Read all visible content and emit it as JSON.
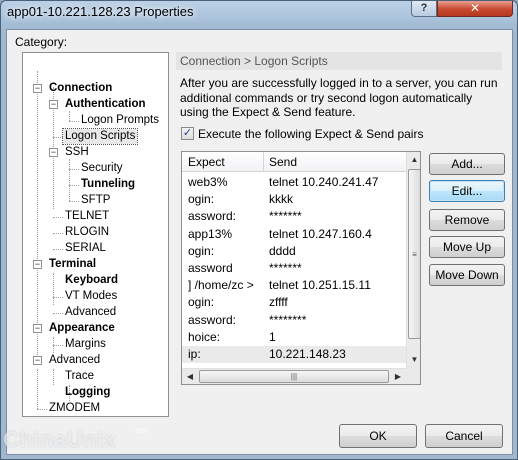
{
  "window": {
    "title": "app01-10.221.128.23 Properties",
    "help_label": "?",
    "close_label": "✕"
  },
  "category_label": "Category:",
  "tree": [
    {
      "label": "Connection",
      "bold": true,
      "selected": false
    },
    {
      "label": "Authentication",
      "bold": true,
      "selected": false
    },
    {
      "label": "Logon Prompts",
      "bold": false,
      "selected": false
    },
    {
      "label": "Logon Scripts",
      "bold": false,
      "selected": true
    },
    {
      "label": "SSH",
      "bold": false,
      "selected": false
    },
    {
      "label": "Security",
      "bold": false,
      "selected": false
    },
    {
      "label": "Tunneling",
      "bold": true,
      "selected": false
    },
    {
      "label": "SFTP",
      "bold": false,
      "selected": false
    },
    {
      "label": "TELNET",
      "bold": false,
      "selected": false
    },
    {
      "label": "RLOGIN",
      "bold": false,
      "selected": false
    },
    {
      "label": "SERIAL",
      "bold": false,
      "selected": false
    },
    {
      "label": "Terminal",
      "bold": true,
      "selected": false
    },
    {
      "label": "Keyboard",
      "bold": true,
      "selected": false
    },
    {
      "label": "VT Modes",
      "bold": false,
      "selected": false
    },
    {
      "label": "Advanced",
      "bold": false,
      "selected": false
    },
    {
      "label": "Appearance",
      "bold": true,
      "selected": false
    },
    {
      "label": "Margins",
      "bold": false,
      "selected": false
    },
    {
      "label": "Advanced",
      "bold": false,
      "selected": false
    },
    {
      "label": "Trace",
      "bold": false,
      "selected": false
    },
    {
      "label": "Logging",
      "bold": true,
      "selected": false
    },
    {
      "label": "ZMODEM",
      "bold": false,
      "selected": false
    }
  ],
  "page": {
    "header": "Connection > Logon Scripts",
    "description": "After you are successfully logged in to a server, you can run additional commands or try second logon automatically using the Expect & Send feature.",
    "checkbox_label": "Execute the following Expect & Send pairs",
    "checkbox_checked": true
  },
  "list": {
    "col_expect": "Expect",
    "col_send": "Send",
    "rows": [
      {
        "expect": "web3%",
        "send": "telnet 10.240.241.47"
      },
      {
        "expect": "ogin:",
        "send": "kkkk"
      },
      {
        "expect": "assword:",
        "send": "*******"
      },
      {
        "expect": "app13%",
        "send": "telnet 10.247.160.4"
      },
      {
        "expect": "ogin:",
        "send": "dddd"
      },
      {
        "expect": "assword",
        "send": "*******"
      },
      {
        "expect": "] /home/zc >",
        "send": "telnet 10.251.15.11"
      },
      {
        "expect": "ogin:",
        "send": "zffff"
      },
      {
        "expect": "assword:",
        "send": "********"
      },
      {
        "expect": "hoice:",
        "send": "1"
      },
      {
        "expect": "ip:",
        "send": "10.221.148.23"
      }
    ]
  },
  "buttons": {
    "add": "Add...",
    "edit": "Edit...",
    "remove": "Remove",
    "move_up": "Move Up",
    "move_down": "Move Down",
    "ok": "OK",
    "cancel": "Cancel"
  },
  "watermark": {
    "text": "ChinaUnix",
    "sup": "net"
  }
}
